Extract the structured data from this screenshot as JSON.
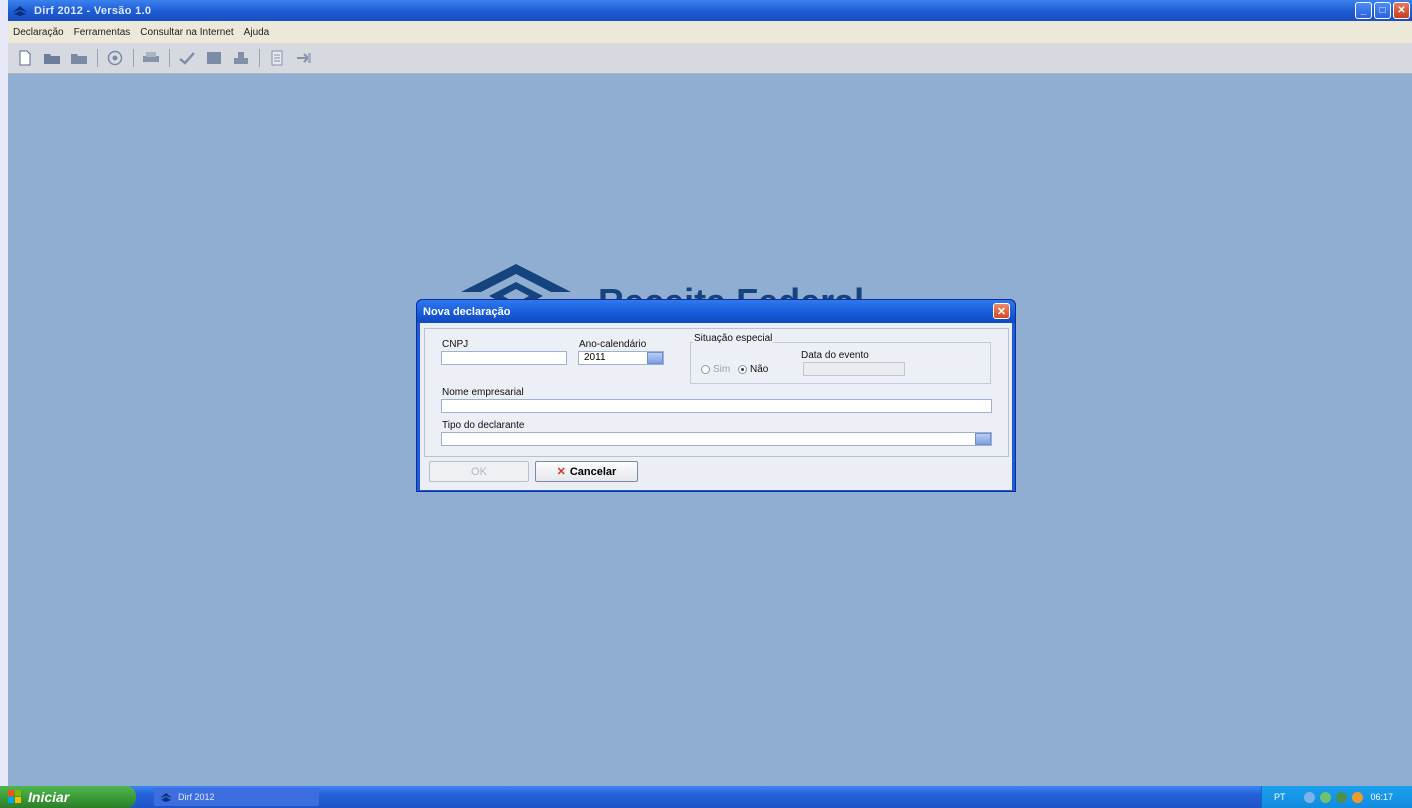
{
  "window": {
    "title": "Dirf 2012 - Versão 1.0"
  },
  "menu": [
    "Declaração",
    "Ferramentas",
    "Consultar na Internet",
    "Ajuda"
  ],
  "toolbar_icons": [
    "new-file-icon",
    "open-folder-icon",
    "folder-icon",
    "sphere-icon",
    "print-icon",
    "check-icon",
    "grid-icon",
    "stamp-icon",
    "document-icon",
    "export-icon"
  ],
  "logo": {
    "text": "Receita Federal"
  },
  "dialog": {
    "title": "Nova declaração",
    "cnpj_label": "CNPJ",
    "cnpj_value": "",
    "ano_label": "Ano-calendário",
    "ano_value": "2011",
    "situacao_label": "Situação especial",
    "sim_label": "Sim",
    "nao_label": "Não",
    "data_evento_label": "Data do evento",
    "data_evento_value": "",
    "nome_label": "Nome empresarial",
    "nome_value": "",
    "tipo_label": "Tipo do declarante",
    "tipo_value": "",
    "ok_label": "OK",
    "cancel_label": "Cancelar"
  },
  "taskbar": {
    "start_label": "Iniciar",
    "task_label": "Dirf 2012",
    "lang": "PT",
    "clock": "06:17"
  },
  "colors": {
    "desktop": "#90aed2",
    "titlebar": "#1b5bd3",
    "start": "#3a9a36"
  }
}
